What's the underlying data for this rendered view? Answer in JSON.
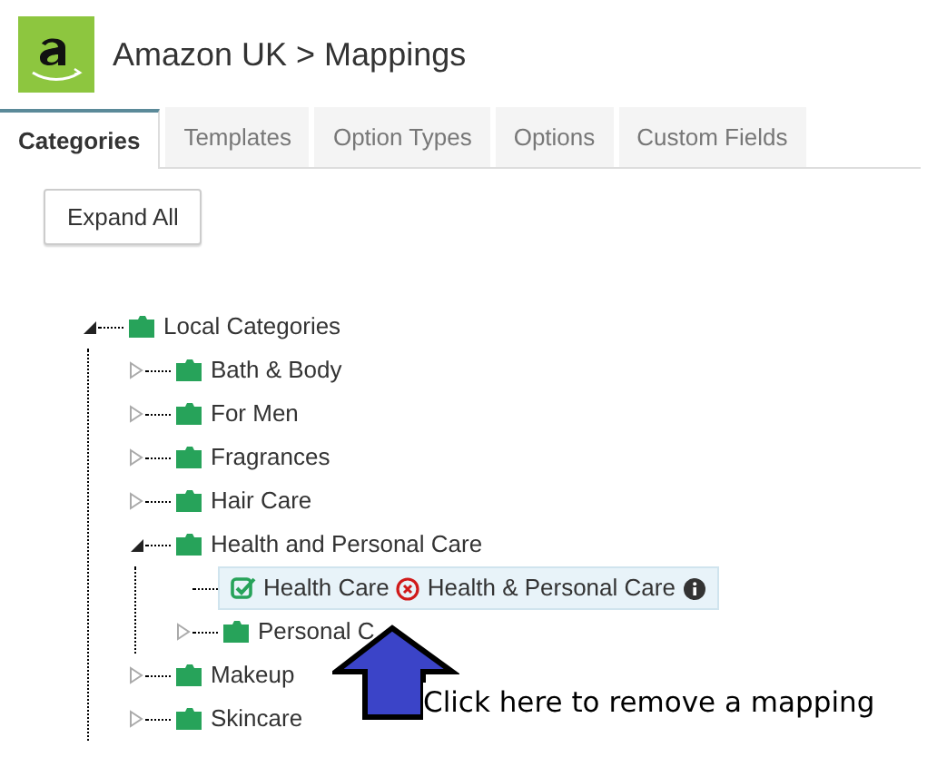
{
  "header": {
    "title": "Amazon UK > Mappings"
  },
  "tabs": [
    {
      "label": "Categories",
      "selected": true
    },
    {
      "label": "Templates",
      "selected": false
    },
    {
      "label": "Option Types",
      "selected": false
    },
    {
      "label": "Options",
      "selected": false
    },
    {
      "label": "Custom Fields",
      "selected": false
    }
  ],
  "expand_button": "Expand All",
  "tree": {
    "label": "Local Categories",
    "expanded": true,
    "children": [
      {
        "label": "Bath & Body",
        "expanded": false
      },
      {
        "label": "For Men",
        "expanded": false
      },
      {
        "label": "Fragrances",
        "expanded": false
      },
      {
        "label": "Hair Care",
        "expanded": false
      },
      {
        "label": "Health and Personal Care",
        "expanded": true,
        "children": [
          {
            "label": "Health Care",
            "kind": "mapped",
            "mapping": "Health & Personal Care",
            "selected": true
          },
          {
            "label": "Personal C",
            "expanded": false
          }
        ]
      },
      {
        "label": "Makeup",
        "expanded": false
      },
      {
        "label": "Skincare",
        "expanded": false
      }
    ]
  },
  "annotation": "Click here to remove a mapping"
}
